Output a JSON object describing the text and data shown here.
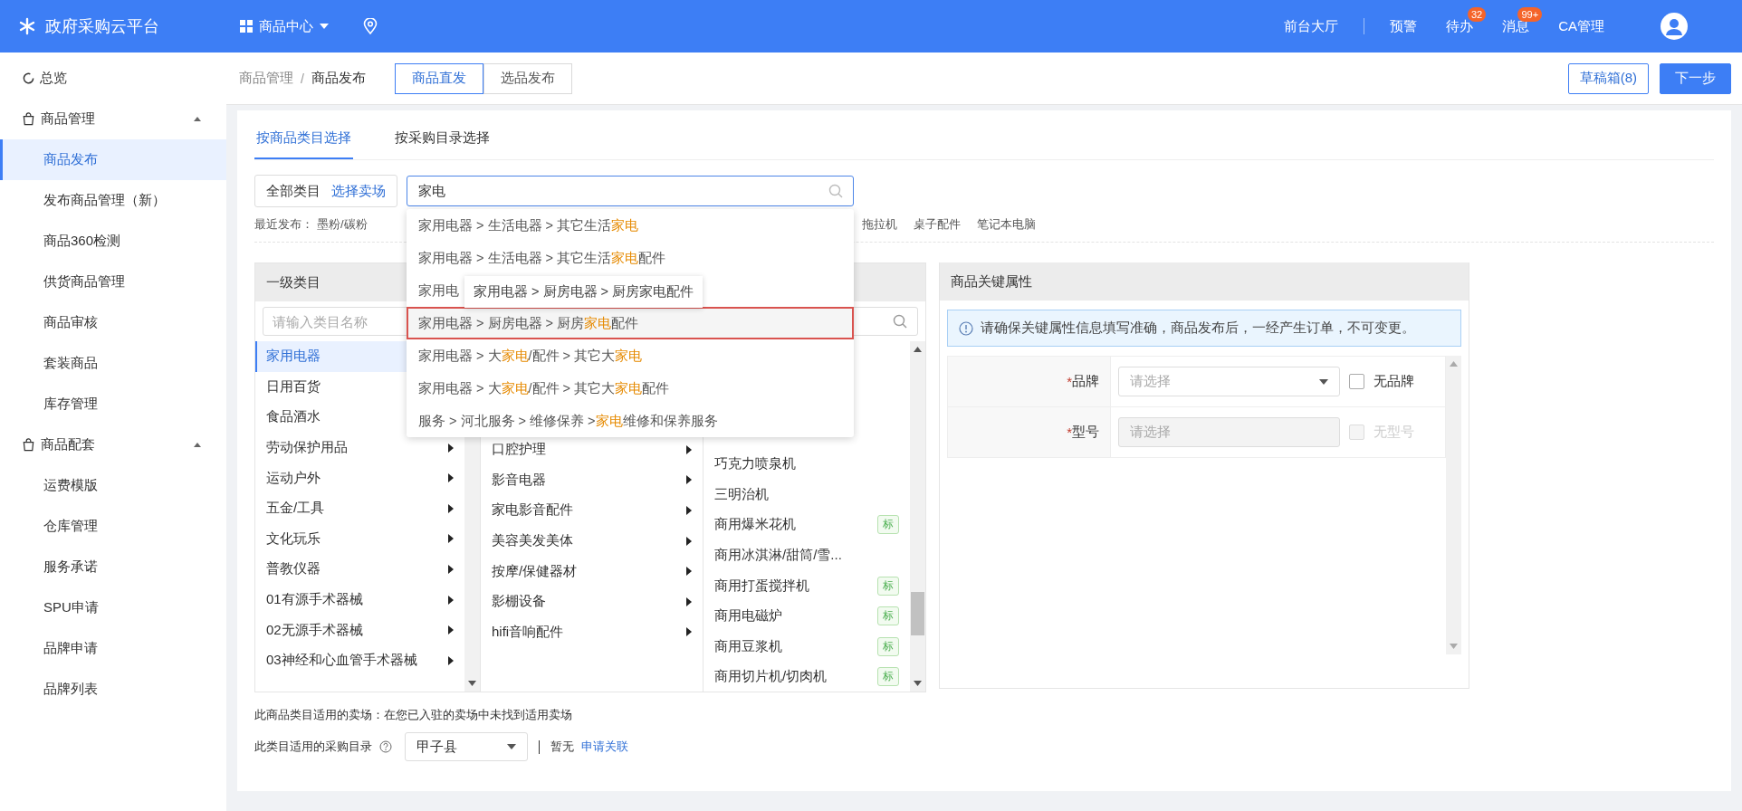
{
  "header": {
    "title": "政府采购云平台",
    "module": "商品中心",
    "nav": [
      {
        "label": "前台大厅"
      },
      {
        "label": "预警"
      },
      {
        "label": "待办",
        "badge": "32"
      },
      {
        "label": "消息",
        "badge": "99+"
      },
      {
        "label": "CA管理"
      }
    ]
  },
  "sidebar": {
    "items": [
      {
        "label": "总览",
        "kind": "link",
        "selected": false
      },
      {
        "label": "商品管理",
        "kind": "group",
        "expanded": true,
        "children": [
          {
            "label": "商品发布",
            "selected": true
          },
          {
            "label": "发布商品管理（新）",
            "selected": false
          },
          {
            "label": "商品360检测",
            "selected": false
          },
          {
            "label": "供货商品管理",
            "selected": false
          },
          {
            "label": "商品审核",
            "selected": false
          },
          {
            "label": "套装商品",
            "selected": false
          },
          {
            "label": "库存管理",
            "selected": false
          }
        ]
      },
      {
        "label": "商品配套",
        "kind": "group",
        "expanded": true,
        "children": [
          {
            "label": "运费模版",
            "selected": false
          },
          {
            "label": "仓库管理",
            "selected": false
          },
          {
            "label": "服务承诺",
            "selected": false
          },
          {
            "label": "SPU申请",
            "selected": false
          },
          {
            "label": "品牌申请",
            "selected": false
          },
          {
            "label": "品牌列表",
            "selected": false
          }
        ]
      }
    ]
  },
  "breadcrumb": [
    "商品管理",
    "商品发布"
  ],
  "breadcrumb_separator": "/",
  "mode_tabs": [
    {
      "label": "商品直发",
      "selected": true
    },
    {
      "label": "选品发布",
      "selected": false
    }
  ],
  "actions": [
    {
      "label": "草稿箱(8)",
      "kind": "secondary"
    },
    {
      "label": "下一步",
      "kind": "primary"
    }
  ],
  "tabs": [
    {
      "label": "按商品类目选择",
      "selected": true
    },
    {
      "label": "按采购目录选择",
      "selected": false
    }
  ],
  "scope": {
    "label": "全部类目",
    "link": "选择卖场"
  },
  "search": {
    "value": "家电"
  },
  "suggestions": [
    {
      "selected": false,
      "parts": [
        {
          "text": "家用电器 > 生活电器 > 其它生活",
          "match": false
        },
        {
          "text": "家电",
          "match": true
        }
      ]
    },
    {
      "selected": false,
      "parts": [
        {
          "text": "家用电器 > 生活电器 > 其它生活",
          "match": false
        },
        {
          "text": "家电",
          "match": true
        },
        {
          "text": "配件",
          "match": false
        }
      ]
    },
    {
      "selected": false,
      "parts": [
        {
          "text": "家用电",
          "match": false
        }
      ]
    },
    {
      "selected": true,
      "parts": [
        {
          "text": "家用电器 > 厨房电器 > 厨房",
          "match": false
        },
        {
          "text": "家电",
          "match": true
        },
        {
          "text": "配件",
          "match": false
        }
      ]
    },
    {
      "selected": false,
      "parts": [
        {
          "text": "家用电器 > 大",
          "match": false
        },
        {
          "text": "家电",
          "match": true
        },
        {
          "text": "/配件 > 其它大",
          "match": false
        },
        {
          "text": "家电",
          "match": true
        }
      ]
    },
    {
      "selected": false,
      "parts": [
        {
          "text": "家用电器 > 大",
          "match": false
        },
        {
          "text": "家电",
          "match": true
        },
        {
          "text": "/配件 > 其它大",
          "match": false
        },
        {
          "text": "家电",
          "match": true
        },
        {
          "text": "配件",
          "match": false
        }
      ]
    },
    {
      "selected": false,
      "parts": [
        {
          "text": "服务 > 河北服务 > 维修保养 > ",
          "match": false
        },
        {
          "text": "家电",
          "match": true
        },
        {
          "text": "维修和保养服务",
          "match": false
        }
      ]
    }
  ],
  "tooltip": "家用电器 > 厨房电器 > 厨房家电配件",
  "recent": {
    "label": "最近发布：",
    "items_before": [
      "墨粉/碳粉"
    ],
    "items_after": [
      "拖拉机",
      "桌子配件",
      "笔记本电脑"
    ]
  },
  "categories": {
    "header": "一级类目",
    "search_placeholder": "请输入类目名称",
    "level1": [
      {
        "label": "家用电器",
        "selected": true
      },
      {
        "label": "日用百货",
        "selected": false
      },
      {
        "label": "食品酒水",
        "selected": false
      },
      {
        "label": "劳动保护用品",
        "selected": false,
        "has_children": true
      },
      {
        "label": "运动户外",
        "selected": false,
        "has_children": true
      },
      {
        "label": "五金/工具",
        "selected": false,
        "has_children": true
      },
      {
        "label": "文化玩乐",
        "selected": false,
        "has_children": true
      },
      {
        "label": "普教仪器",
        "selected": false,
        "has_children": true
      },
      {
        "label": "01有源手术器械",
        "selected": false,
        "has_children": true
      },
      {
        "label": "02无源手术器械",
        "selected": false,
        "has_children": true
      },
      {
        "label": "03神经和心血管手术器械",
        "selected": false,
        "has_children": true
      }
    ],
    "level2": [
      {
        "label": "口腔护理"
      },
      {
        "label": "影音电器"
      },
      {
        "label": "家电影音配件"
      },
      {
        "label": "美容美发美体"
      },
      {
        "label": "按摩/保健器材"
      },
      {
        "label": "影棚设备"
      },
      {
        "label": "hifi音响配件"
      }
    ],
    "level3": [
      {
        "label": "巧克力喷泉机"
      },
      {
        "label": "三明治机"
      },
      {
        "label": "商用爆米花机",
        "badge": "标"
      },
      {
        "label": "商用冰淇淋/甜筒/雪..."
      },
      {
        "label": "商用打蛋搅拌机",
        "badge": "标"
      },
      {
        "label": "商用电磁炉",
        "badge": "标"
      },
      {
        "label": "商用豆浆机",
        "badge": "标"
      },
      {
        "label": "商用切片机/切肉机",
        "badge": "标"
      }
    ]
  },
  "attributes": {
    "title": "商品关键属性",
    "notice": "请确保关键属性信息填写准确，商品发布后，一经产生订单，不可变更。",
    "fields": [
      {
        "required_mark": "*",
        "label": "品牌",
        "placeholder": "请选择",
        "disabled": false,
        "checkbox": {
          "label": "无品牌",
          "checked": false
        }
      },
      {
        "required_mark": "*",
        "label": "型号",
        "placeholder": "请选择",
        "disabled": true,
        "checkbox": {
          "label": "无型号",
          "checked": false
        }
      }
    ]
  },
  "market_note": "此商品类目适用的卖场：在您已入驻的卖场中未找到适用卖场",
  "catalog": {
    "label": "此类目适用的采购目录",
    "value": "甲子县",
    "status": "暂无",
    "link": "申请关联"
  }
}
